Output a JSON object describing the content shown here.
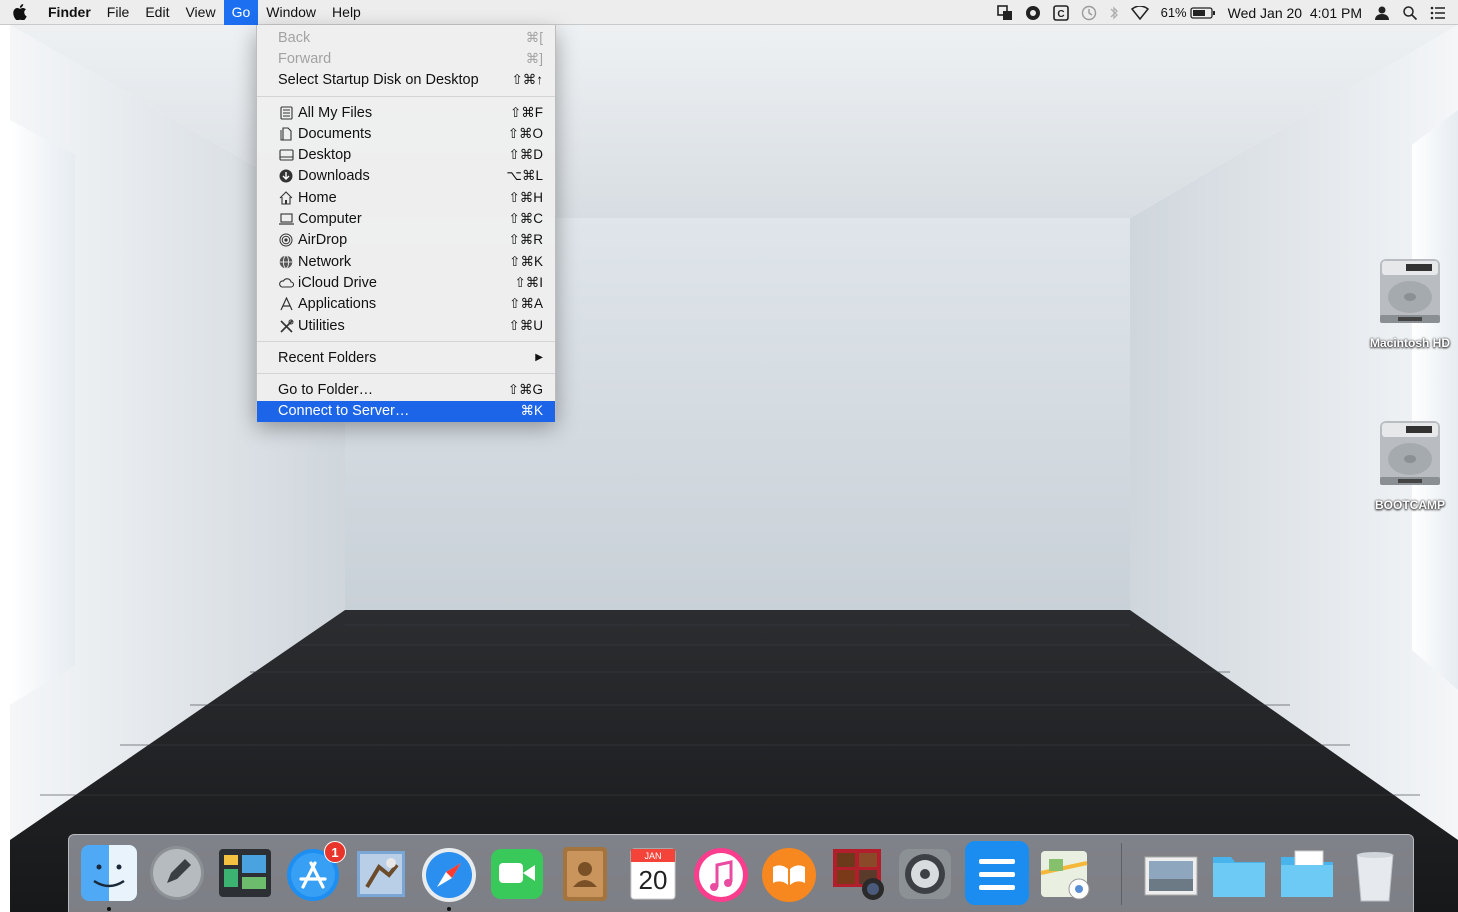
{
  "menubar": {
    "apple_icon": "apple-logo-icon",
    "app_name": "Finder",
    "menus": [
      "File",
      "Edit",
      "View",
      "Go",
      "Window",
      "Help"
    ],
    "active_menu": "Go",
    "status": {
      "battery_percent": "61%",
      "clock": "Wed Jan 20  4:01 PM"
    }
  },
  "go_menu": {
    "items": [
      {
        "label": "Back",
        "shortcut": "⌘[",
        "disabled": true
      },
      {
        "label": "Forward",
        "shortcut": "⌘]",
        "disabled": true
      },
      {
        "label": "Select Startup Disk on Desktop",
        "shortcut": "⇧⌘↑"
      },
      {
        "label": "All My Files",
        "shortcut": "⇧⌘F",
        "icon": "all-files-icon"
      },
      {
        "label": "Documents",
        "shortcut": "⇧⌘O",
        "icon": "documents-icon"
      },
      {
        "label": "Desktop",
        "shortcut": "⇧⌘D",
        "icon": "desktop-icon"
      },
      {
        "label": "Downloads",
        "shortcut": "⌥⌘L",
        "icon": "downloads-icon"
      },
      {
        "label": "Home",
        "shortcut": "⇧⌘H",
        "icon": "home-icon"
      },
      {
        "label": "Computer",
        "shortcut": "⇧⌘C",
        "icon": "computer-icon"
      },
      {
        "label": "AirDrop",
        "shortcut": "⇧⌘R",
        "icon": "airdrop-icon"
      },
      {
        "label": "Network",
        "shortcut": "⇧⌘K",
        "icon": "network-icon"
      },
      {
        "label": "iCloud Drive",
        "shortcut": "⇧⌘I",
        "icon": "icloud-icon"
      },
      {
        "label": "Applications",
        "shortcut": "⇧⌘A",
        "icon": "applications-icon"
      },
      {
        "label": "Utilities",
        "shortcut": "⇧⌘U",
        "icon": "utilities-icon"
      },
      {
        "label": "Recent Folders",
        "shortcut": "▶"
      },
      {
        "label": "Go to Folder…",
        "shortcut": "⇧⌘G"
      },
      {
        "label": "Connect to Server…",
        "shortcut": "⌘K",
        "highlighted": true
      }
    ]
  },
  "desktop_icons": [
    {
      "label": "Macintosh HD",
      "icon": "hard-drive-icon"
    },
    {
      "label": "BOOTCAMP",
      "icon": "hard-drive-icon"
    }
  ],
  "dock": {
    "apps": [
      "finder-icon",
      "launchpad-icon",
      "mission-control-icon",
      "app-store-icon",
      "mail-icon",
      "safari-icon",
      "facetime-icon",
      "contacts-icon",
      "calendar-icon",
      "itunes-icon",
      "ibooks-icon",
      "photo-booth-icon",
      "system-preferences-icon",
      "notes-icon",
      "maps-icon",
      "preview-icon",
      "folder-icon",
      "documents-folder-icon",
      "trash-icon"
    ],
    "app_store_badge": "1",
    "calendar_month": "JAN",
    "calendar_day": "20"
  },
  "colors": {
    "menu_highlight": "#1c65e8",
    "badge_red": "#e8342a"
  }
}
